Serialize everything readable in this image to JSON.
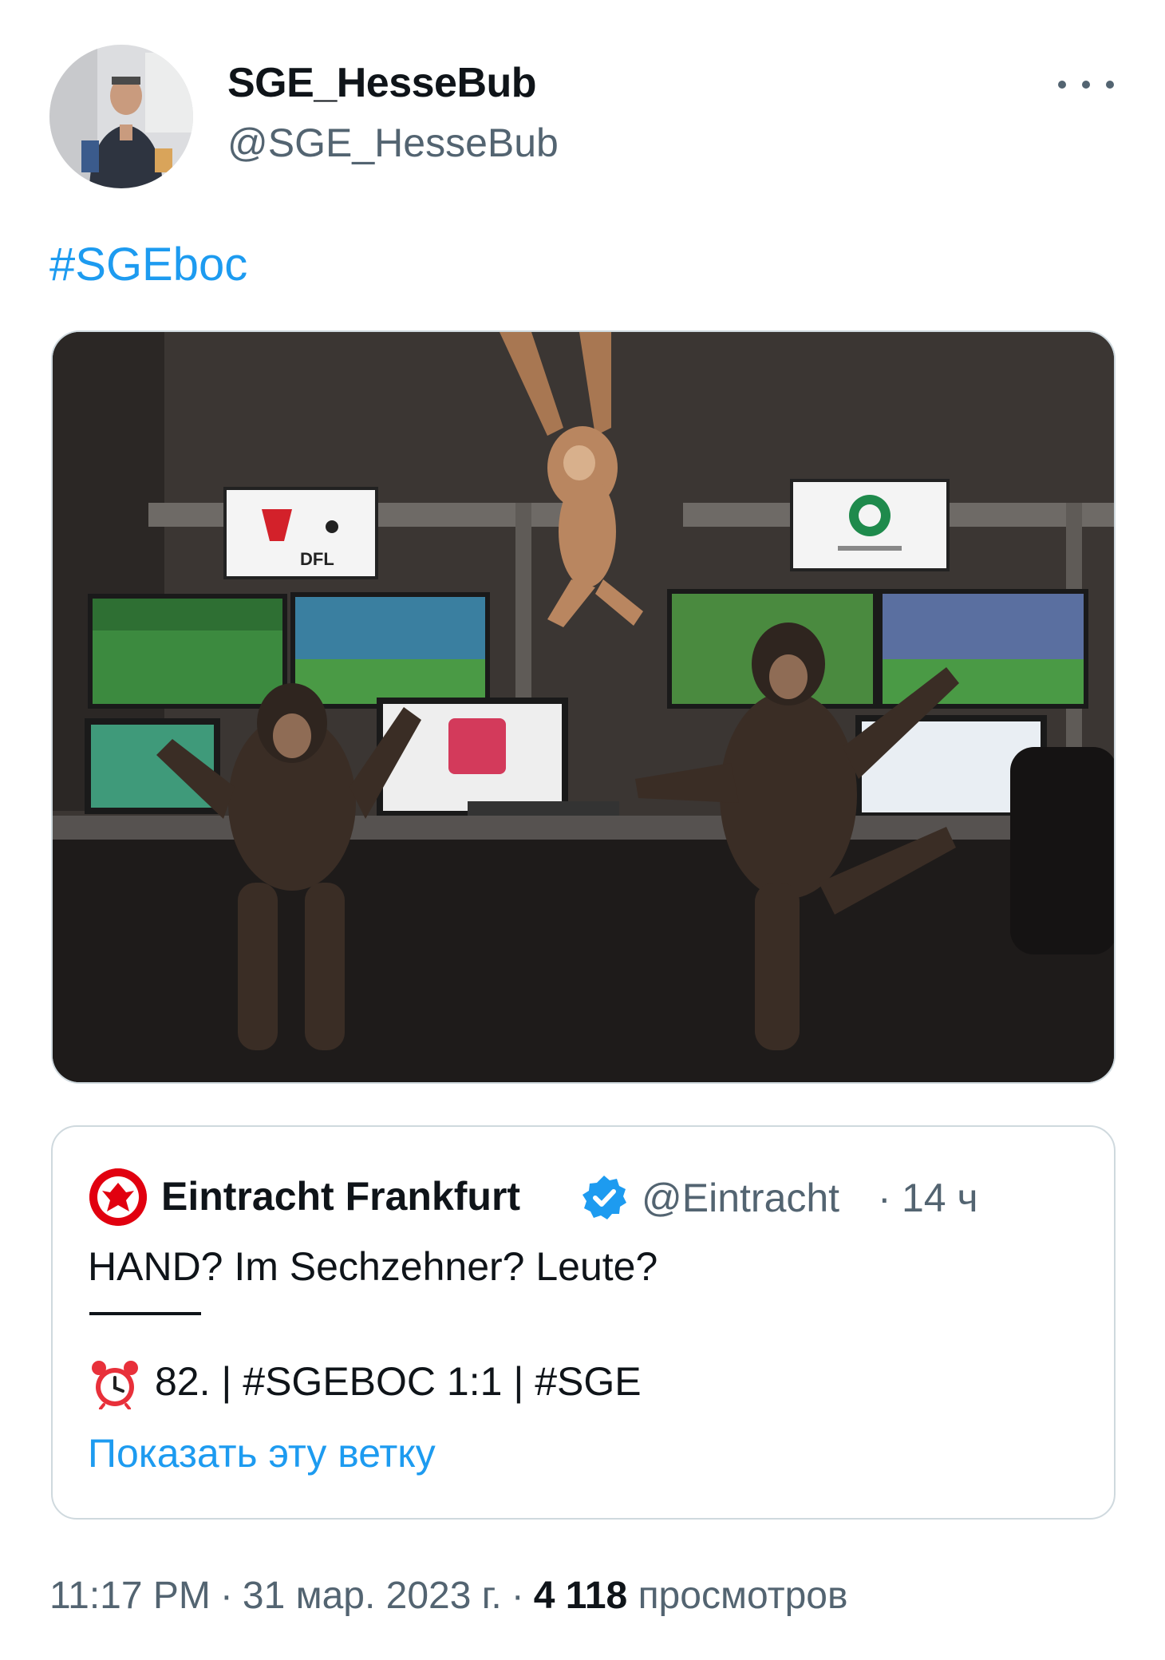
{
  "author": {
    "display_name": "SGE_HesseBub",
    "handle": "@SGE_HesseBub"
  },
  "more_icon": "more-horizontal-icon",
  "tweet_text": {
    "hashtag": "#SGEboc"
  },
  "media": {
    "logos": {
      "dfl": "DFL"
    }
  },
  "quoted_tweet": {
    "name": "Eintracht Frankfurt",
    "verified_icon": "verified-badge-icon",
    "handle": "@Eintracht",
    "dot": "·",
    "time": "14 ч",
    "line1": "HAND? Im Sechzehner? Leute?",
    "alarm_icon": "alarm-clock-icon",
    "line3": "82. | #SGEBOC 1:1 | #SGE",
    "show_thread": "Показать эту ветку"
  },
  "footer": {
    "time": "11:17 PM",
    "sep": "·",
    "date": "31 мар. 2023 г.",
    "views_count": "4 118",
    "views_label": "просмотров"
  },
  "colors": {
    "link": "#1d9bf0",
    "secondary_text": "#536471",
    "border": "#cfd9de"
  }
}
